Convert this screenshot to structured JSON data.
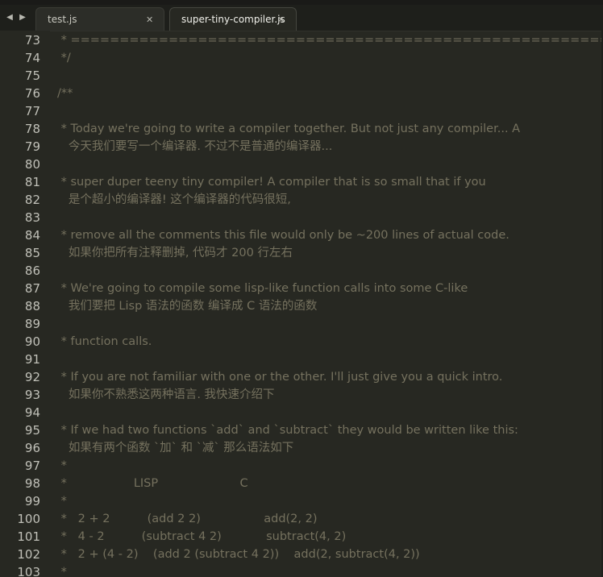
{
  "tabs": [
    {
      "label": "test.js",
      "close": "✕"
    },
    {
      "label": "super-tiny-compiler.js",
      "close": "✕"
    }
  ],
  "nav": {
    "back": "◀",
    "forward": "▶"
  },
  "lines": [
    {
      "n": "73",
      "t": " * ================================================================================="
    },
    {
      "n": "74",
      "t": " */"
    },
    {
      "n": "75",
      "t": ""
    },
    {
      "n": "76",
      "t": "/**"
    },
    {
      "n": "77",
      "t": ""
    },
    {
      "n": "78",
      "t": " * Today we're going to write a compiler together. But not just any compiler... A"
    },
    {
      "n": "79",
      "t": "   今天我们要写一个编译器. 不过不是普通的编译器..."
    },
    {
      "n": "80",
      "t": ""
    },
    {
      "n": "81",
      "t": " * super duper teeny tiny compiler! A compiler that is so small that if you"
    },
    {
      "n": "82",
      "t": "   是个超小的编译器! 这个编译器的代码很短,"
    },
    {
      "n": "83",
      "t": ""
    },
    {
      "n": "84",
      "t": " * remove all the comments this file would only be ~200 lines of actual code."
    },
    {
      "n": "85",
      "t": "   如果你把所有注释删掉, 代码才 200 行左右"
    },
    {
      "n": "86",
      "t": ""
    },
    {
      "n": "87",
      "t": " * We're going to compile some lisp-like function calls into some C-like"
    },
    {
      "n": "88",
      "t": "   我们要把 Lisp 语法的函数 编译成 C 语法的函数"
    },
    {
      "n": "89",
      "t": ""
    },
    {
      "n": "90",
      "t": " * function calls."
    },
    {
      "n": "91",
      "t": ""
    },
    {
      "n": "92",
      "t": " * If you are not familiar with one or the other. I'll just give you a quick intro."
    },
    {
      "n": "93",
      "t": "   如果你不熟悉这两种语言. 我快速介绍下"
    },
    {
      "n": "94",
      "t": ""
    },
    {
      "n": "95",
      "t": " * If we had two functions `add` and `subtract` they would be written like this:"
    },
    {
      "n": "96",
      "t": "   如果有两个函数 `加` 和 `减` 那么语法如下"
    },
    {
      "n": "97",
      "t": " *"
    },
    {
      "n": "98",
      "t": " *                  LISP                      C"
    },
    {
      "n": "99",
      "t": " *"
    },
    {
      "n": "100",
      "t": " *   2 + 2          (add 2 2)                 add(2, 2)"
    },
    {
      "n": "101",
      "t": " *   4 - 2          (subtract 4 2)            subtract(4, 2)"
    },
    {
      "n": "102",
      "t": " *   2 + (4 - 2)    (add 2 (subtract 4 2))    add(2, subtract(4, 2))"
    },
    {
      "n": "103",
      "t": " *"
    }
  ]
}
